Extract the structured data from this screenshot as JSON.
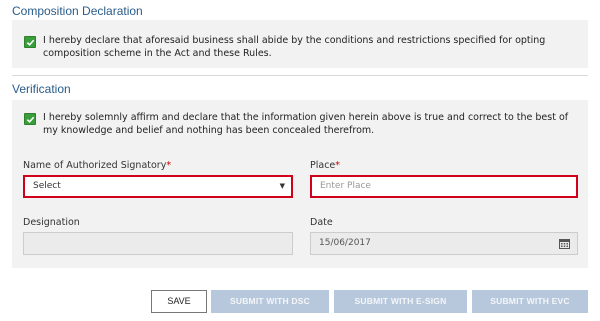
{
  "composition": {
    "title": "Composition Declaration",
    "declaration": "I hereby declare that aforesaid business shall abide by the conditions and restrictions specified for opting composition scheme in the Act and these Rules.",
    "checked": true
  },
  "verification": {
    "title": "Verification",
    "declaration": "I hereby solemnly affirm and declare that the information given herein above is true and correct to the best of my knowledge and belief and nothing has been concealed therefrom.",
    "checked": true
  },
  "form": {
    "signatory_label": "Name of Authorized Signatory",
    "signatory_value": "Select",
    "place_label": "Place",
    "place_placeholder": "Enter Place",
    "required_mark": "*",
    "designation_label": "Designation",
    "designation_value": "",
    "date_label": "Date",
    "date_value": "15/06/2017"
  },
  "buttons": {
    "save": "SAVE",
    "submit_dsc": "SUBMIT WITH DSC",
    "submit_esign": "SUBMIT WITH E-SIGN",
    "submit_evc": "SUBMIT WITH EVC"
  },
  "colors": {
    "section_title": "#2a5c8a",
    "checkbox": "#3a9e3a",
    "error_border": "#d0021b",
    "required": "#cc0000",
    "disabled_button": "#b8c8dc"
  }
}
